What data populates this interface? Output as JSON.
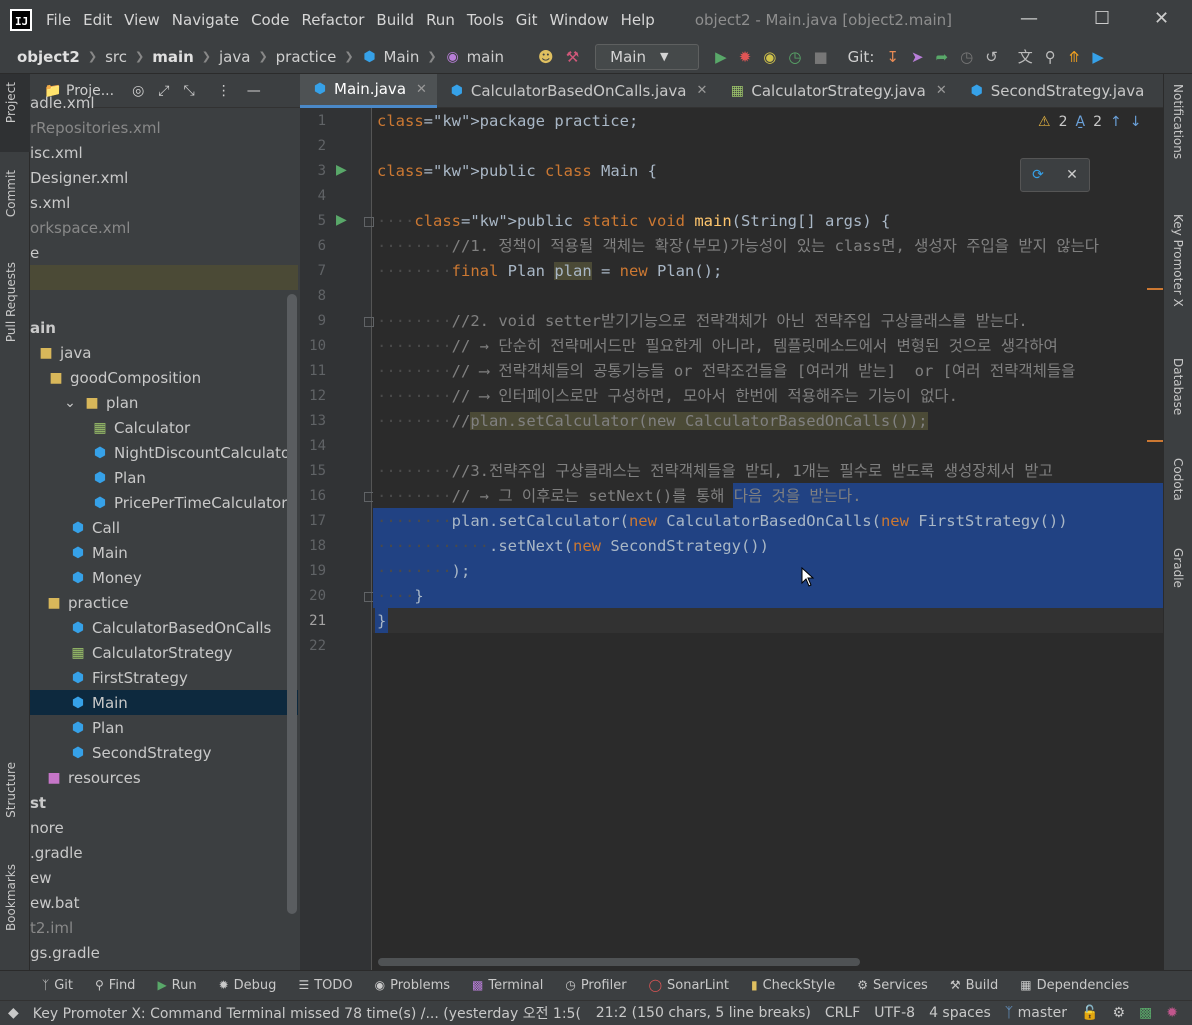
{
  "titlebar": {
    "logo": "IJ",
    "menu": [
      "File",
      "Edit",
      "View",
      "Navigate",
      "Code",
      "Refactor",
      "Build",
      "Run",
      "Tools",
      "Git",
      "Window",
      "Help"
    ],
    "window_title": "object2 - Main.java [object2.main]"
  },
  "navbar": {
    "breadcrumbs": [
      "object2",
      "src",
      "main",
      "java",
      "practice",
      "Main",
      "main"
    ],
    "run_config": "Main",
    "git_label": "Git:"
  },
  "left_strip": [
    "Project",
    "Commit",
    "Pull Requests",
    "Structure",
    "Bookmarks"
  ],
  "right_strip": [
    "Notifications",
    "Key Promoter X",
    "Database",
    "Codota",
    "Gradle"
  ],
  "project": {
    "header": "Proje...",
    "rows": [
      {
        "label": "adle.xml",
        "icon": "file"
      },
      {
        "label": "rRepositories.xml",
        "icon": "file"
      },
      {
        "label": "isc.xml",
        "icon": "file"
      },
      {
        "label": "Designer.xml",
        "icon": "file"
      },
      {
        "label": "s.xml",
        "icon": "file"
      },
      {
        "label": "orkspace.xml",
        "icon": "file"
      },
      {
        "label": "e",
        "icon": "file"
      },
      {
        "label": "",
        "icon": "none"
      },
      {
        "label": "",
        "icon": "none"
      },
      {
        "label": "ain",
        "icon": "none"
      },
      {
        "label": "java",
        "icon": "folder"
      },
      {
        "label": "goodComposition",
        "icon": "folder"
      },
      {
        "label": "plan",
        "icon": "folder"
      },
      {
        "label": "Calculator",
        "icon": "interface"
      },
      {
        "label": "NightDiscountCalculator",
        "icon": "class"
      },
      {
        "label": "Plan",
        "icon": "class"
      },
      {
        "label": "PricePerTimeCalculator",
        "icon": "class"
      },
      {
        "label": "Call",
        "icon": "class"
      },
      {
        "label": "Main",
        "icon": "class"
      },
      {
        "label": "Money",
        "icon": "class"
      },
      {
        "label": "practice",
        "icon": "folder"
      },
      {
        "label": "CalculatorBasedOnCalls",
        "icon": "class"
      },
      {
        "label": "CalculatorStrategy",
        "icon": "interface"
      },
      {
        "label": "FirstStrategy",
        "icon": "class"
      },
      {
        "label": "Main",
        "icon": "class"
      },
      {
        "label": "Plan",
        "icon": "class"
      },
      {
        "label": "SecondStrategy",
        "icon": "class"
      },
      {
        "label": "resources",
        "icon": "resources"
      },
      {
        "label": "st",
        "icon": "none"
      },
      {
        "label": "nore",
        "icon": "none"
      },
      {
        "label": ".gradle",
        "icon": "none"
      },
      {
        "label": "ew",
        "icon": "none"
      },
      {
        "label": "ew.bat",
        "icon": "none"
      },
      {
        "label": "t2.iml",
        "icon": "none"
      },
      {
        "label": "gs.gradle",
        "icon": "none"
      }
    ]
  },
  "editor": {
    "tabs": [
      {
        "label": "Main.java",
        "active": true
      },
      {
        "label": "CalculatorBasedOnCalls.java",
        "active": false
      },
      {
        "label": "CalculatorStrategy.java",
        "active": false
      },
      {
        "label": "SecondStrategy.java",
        "active": false
      }
    ],
    "warnings": "2",
    "typos": "2",
    "current_line": 21,
    "lines": [
      "package practice;",
      "",
      "public class Main {",
      "",
      "    public static void main(String[] args) {",
      "        //1. 정책이 적용될 객체는 확장(부모)가능성이 있는 class면, 생성자 주입을 받지 않는다",
      "        final Plan plan = new Plan();",
      "",
      "        //2. void setter받기기능으로 전략객체가 아닌 전략주입 구상클래스를 받는다.",
      "        // → 단순히 전략메서드만 필요한게 아니라, 템플릿메소드에서 변형된 것으로 생각하여",
      "        // ⟶ 전략객체들의 공통기능들 or 전략조건들을 [여러개 받는]  or [여러 전략객체들을",
      "        // ⟶ 인터페이스로만 구성하면, 모아서 한번에 적용해주는 기능이 없다.",
      "        //plan.setCalculator(new CalculatorBasedOnCalls());",
      "",
      "        //3.전략주입 구상클래스는 전략객체들을 받되, 1개는 필수로 받도록 생성장체서 받고",
      "        // → 그 이후로는 setNext()를 통해 다음 것을 받는다.",
      "        plan.setCalculator(new CalculatorBasedOnCalls(new FirstStrategy())",
      "            .setNext(new SecondStrategy())",
      "        );",
      "    }",
      "}",
      ""
    ]
  },
  "bottom_tools": [
    "Git",
    "Find",
    "Run",
    "Debug",
    "TODO",
    "Problems",
    "Terminal",
    "Profiler",
    "SonarLint",
    "CheckStyle",
    "Services",
    "Build",
    "Dependencies"
  ],
  "statusbar": {
    "message": "Key Promoter X: Command Terminal missed 78 time(s) /... (yesterday 오전 1:5(",
    "position": "21:2 (150 chars, 5 line breaks)",
    "line_sep": "CRLF",
    "encoding": "UTF-8",
    "indent": "4 spaces",
    "branch": "master"
  },
  "colors": {
    "accent": "#4a88c7",
    "selection": "#214283",
    "keyword": "#cc7832",
    "method": "#ffc66d",
    "comment": "#808080"
  }
}
